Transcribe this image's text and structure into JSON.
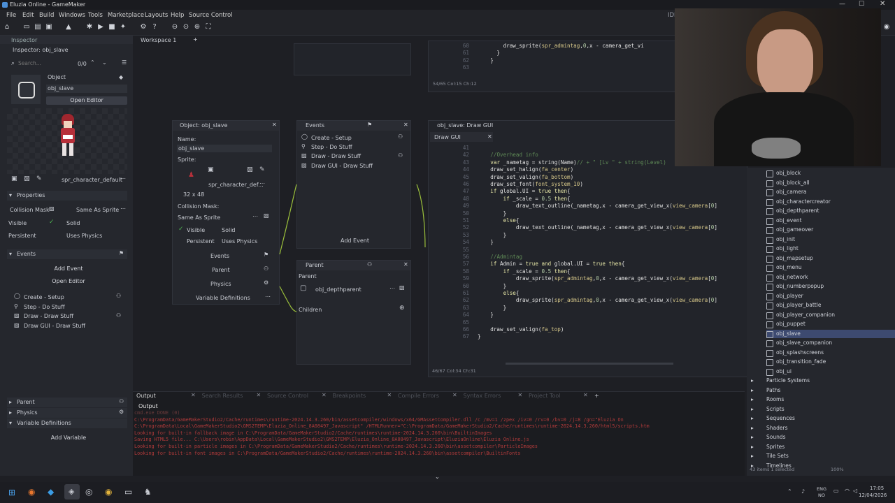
{
  "window": {
    "title": "Eluzia Online - GameMaker",
    "ide_label": "IDE v2"
  },
  "menu": [
    "File",
    "Edit",
    "Build",
    "Windows",
    "Tools",
    "Marketplace",
    "Layouts",
    "Help",
    "Source Control"
  ],
  "tabs": {
    "inspector": "Inspector",
    "workspace": "Workspace 1",
    "add": "+"
  },
  "inspector": {
    "title": "Inspector: obj_slave",
    "search_placeholder": "Search...",
    "counter": "0/0",
    "object_label": "Object",
    "object_name": "obj_slave",
    "open_editor": "Open Editor",
    "sprite_name": "spr_character_default",
    "properties_header": "Properties",
    "collision_mask_label": "Collision Mask",
    "collision_mask_value": "Same As Sprite",
    "visible_label": "Visible",
    "solid_label": "Solid",
    "persistent_label": "Persistent",
    "uses_physics_label": "Uses Physics",
    "events_header": "Events",
    "add_event": "Add Event",
    "open_editor2": "Open Editor",
    "events": [
      "Create - Setup",
      "Step - Do Stuff",
      "Draw - Draw Stuff",
      "Draw GUI - Draw Stuff"
    ],
    "parent_header": "Parent",
    "physics_header": "Physics",
    "variable_definitions_header": "Variable Definitions",
    "add_variable": "Add Variable"
  },
  "object_window": {
    "title": "Object: obj_slave",
    "name_label": "Name:",
    "name_value": "obj_slave",
    "sprite_label": "Sprite:",
    "sprite_value": "spr_character_def...",
    "sprite_size": "32 x 48",
    "collision_mask_label": "Collision Mask:",
    "collision_mask_value": "Same As Sprite",
    "visible": "Visible",
    "solid": "Solid",
    "persistent": "Persistent",
    "uses_physics": "Uses Physics",
    "events_btn": "Events",
    "parent_btn": "Parent",
    "physics_btn": "Physics",
    "variable_definitions_btn": "Variable Definitions"
  },
  "events_window": {
    "title": "Events",
    "items": [
      "Create - Setup",
      "Step - Do Stuff",
      "Draw - Draw Stuff",
      "Draw GUI - Draw Stuff"
    ],
    "add_event": "Add Event"
  },
  "parent_window": {
    "title": "Parent",
    "parent_label": "Parent",
    "parent_value": "obj_depthparent",
    "children_label": "Children"
  },
  "top_code": {
    "lines": [
      {
        "n": "60",
        "code": "        draw_sprite(spr_admintag,0,x - camera_get_vi"
      },
      {
        "n": "61",
        "code": "      }"
      },
      {
        "n": "62",
        "code": "    }"
      },
      {
        "n": "63",
        "code": ""
      }
    ],
    "status": "54/65 Col:15 Ch:12"
  },
  "code_window": {
    "title": "obj_slave: Draw GUI",
    "tab": "Draw GUI",
    "status": "46/67 Col:34 Ch:31",
    "lines": [
      {
        "n": "41",
        "code": ""
      },
      {
        "n": "42",
        "code": "    //Overhead info"
      },
      {
        "n": "43",
        "code": "    var _nametag = string(Name)// + \" [Lv \" + string(Level)"
      },
      {
        "n": "44",
        "code": "    draw_set_halign(fa_center)"
      },
      {
        "n": "45",
        "code": "    draw_set_valign(fa_bottom)"
      },
      {
        "n": "46",
        "code": "    draw_set_font(font_system_10)"
      },
      {
        "n": "47",
        "code": "    if global.UI = true then{"
      },
      {
        "n": "48",
        "code": "        if _scale = 0.5 then{"
      },
      {
        "n": "49",
        "code": "            draw_text_outline(_nametag,x - camera_get_view_x(view_camera[0]"
      },
      {
        "n": "50",
        "code": "        }"
      },
      {
        "n": "51",
        "code": "        else{"
      },
      {
        "n": "52",
        "code": "            draw_text_outline(_nametag,x - camera_get_view_x(view_camera[0]"
      },
      {
        "n": "53",
        "code": "        }"
      },
      {
        "n": "54",
        "code": "    }"
      },
      {
        "n": "55",
        "code": ""
      },
      {
        "n": "56",
        "code": "    //Admintag"
      },
      {
        "n": "57",
        "code": "    if Admin = true and global.UI = true then{"
      },
      {
        "n": "58",
        "code": "        if _scale = 0.5 then{"
      },
      {
        "n": "59",
        "code": "            draw_sprite(spr_admintag,0,x - camera_get_view_x(view_camera[0]"
      },
      {
        "n": "60",
        "code": "        }"
      },
      {
        "n": "61",
        "code": "        else{"
      },
      {
        "n": "62",
        "code": "            draw_sprite(spr_admintag,0,x - camera_get_view_x(view_camera[0]"
      },
      {
        "n": "63",
        "code": "        }"
      },
      {
        "n": "64",
        "code": "    }"
      },
      {
        "n": "65",
        "code": ""
      },
      {
        "n": "66",
        "code": "    draw_set_valign(fa_top)"
      },
      {
        "n": "67",
        "code": "}"
      }
    ]
  },
  "asset_browser": {
    "objects": [
      "obj_block",
      "obj_block_all",
      "obj_camera",
      "obj_charactercreator",
      "obj_depthparent",
      "obj_event",
      "obj_gameover",
      "obj_init",
      "obj_light",
      "obj_mapsetup",
      "obj_menu",
      "obj_network",
      "obj_numberpopup",
      "obj_player",
      "obj_player_battle",
      "obj_player_companion",
      "obj_puppet",
      "obj_slave",
      "obj_slave_companion",
      "obj_splashscreens",
      "obj_transition_fade",
      "obj_ui"
    ],
    "selected": "obj_slave",
    "folders": [
      "Particle Systems",
      "Paths",
      "Rooms",
      "Scripts",
      "Sequences",
      "Shaders",
      "Sounds",
      "Sprites",
      "Tile Sets",
      "Timelines"
    ],
    "status": "43 items   1 selected",
    "zoom": "100%"
  },
  "output": {
    "tabs": [
      "Output",
      "Search Results",
      "Source Control",
      "Breakpoints",
      "Compile Errors",
      "Syntax Errors",
      "Project Tool"
    ],
    "active_tab": "Output",
    "lines": [
      "cmd.exe DONE (0)",
      "C:\\ProgramData/GameMakerStudio2/Cache/runtimes\\runtime-2024.14.3.260/bin/assetcompiler/windows/x64/GMAssetCompiler.dll  /c /mv=1 /zpex /iv=0 /rv=0 /bv=0 /j=8  /gn=\"Eluzia On",
      "C:\\ProgramData\\Local\\GameMakerStudio2\\GMS2TEMP\\Eluzia_Online_8A08497_Javascript\" /HTMLRunner=\"C:\\ProgramData/GameMakerStudio2/Cache/runtimes\\runtime-2024.14.3.260/html5/scripts.htm",
      "Looking for built-in fallback image in C:\\ProgramData/GameMakerStudio2/Cache/runtimes\\runtime-2024.14.3.260\\bin\\BuiltinImages",
      "Saving HTML5 file... C:\\Users\\robin\\AppData\\Local\\GameMakerStudio2\\GMS2TEMP\\Eluzia_Online_8A08497_Javascript\\EluziaOnline\\Eluzia Online.js",
      "Looking for built-in particle images in C:\\ProgramData/GameMakerStudio2/Cache/runtimes\\runtime-2024.14.3.260\\bin\\assetcompiler\\ParticleImages",
      "Looking for built-in font images in C:\\ProgramData/GameMakerStudio2/Cache/runtimes\\runtime-2024.14.3.260\\bin\\assetcompiler\\BuiltinFonts"
    ]
  },
  "taskbar": {
    "lang1": "ENG",
    "lang2": "NO",
    "time": "17:05",
    "date": "12/04/2026"
  },
  "colors": {
    "accent": "#3d4a70",
    "green_check": "#4caf50",
    "error_text": "#b03a3a"
  }
}
